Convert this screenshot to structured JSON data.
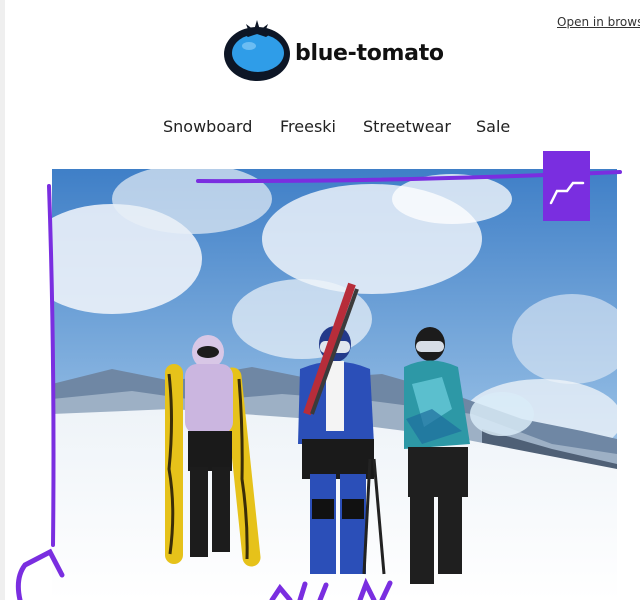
{
  "header": {
    "open_in_browser": "Open in browser",
    "logo_text": "blue-tomato"
  },
  "nav": {
    "items": [
      {
        "label": "Snowboard"
      },
      {
        "label": "Freeski"
      },
      {
        "label": "Streetwear"
      },
      {
        "label": "Sale"
      }
    ]
  },
  "colors": {
    "accent_purple": "#7a2ee0",
    "logo_blue": "#2f9de8",
    "logo_dark": "#0d1626"
  },
  "icons": {
    "corner_badge": "corner-arrow-icon",
    "logo": "tomato-icon"
  }
}
